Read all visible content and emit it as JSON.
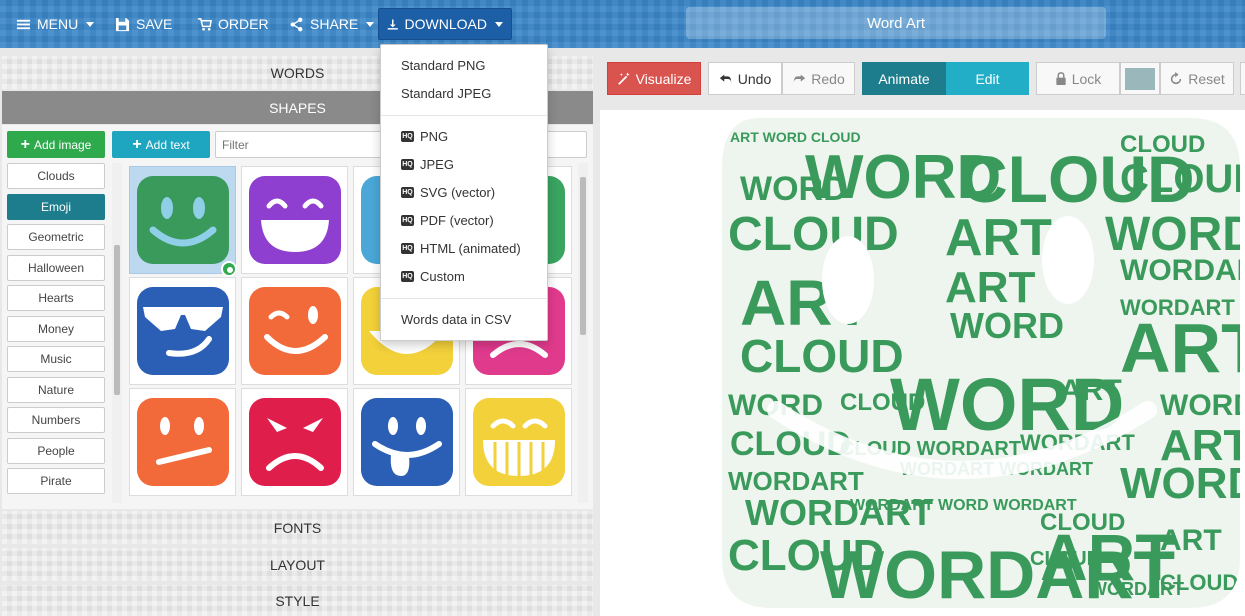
{
  "topbar": {
    "menu": "MENU",
    "save": "SAVE",
    "order": "ORDER",
    "share": "SHARE",
    "download": "DOWNLOAD",
    "title": "Word Art"
  },
  "panels": {
    "words": "WORDS",
    "shapes": "SHAPES",
    "fonts": "FONTS",
    "layout": "LAYOUT",
    "style": "STYLE"
  },
  "shapes": {
    "add_image": "Add image",
    "add_text": "Add text",
    "filter_placeholder": "Filter",
    "categories": [
      "Clouds",
      "Emoji",
      "Geometric",
      "Halloween",
      "Hearts",
      "Money",
      "Music",
      "Nature",
      "Numbers",
      "People",
      "Pirate"
    ],
    "selected_category": "Emoji",
    "emoji_colors": [
      "#3a9a5b",
      "#8e3fd0",
      "#4aa7d6",
      "#3aa460",
      "#2a5fb5",
      "#f26a3a",
      "#f3d13a",
      "#e03a8c",
      "#f26a3a",
      "#e01e4c",
      "#2a5fb5",
      "#f3d13a"
    ]
  },
  "download_menu": {
    "items": [
      "Standard PNG",
      "Standard JPEG"
    ],
    "hd_badge": "HQ",
    "hd_items": [
      "PNG",
      "JPEG",
      "SVG (vector)",
      "PDF (vector)",
      "HTML (animated)",
      "Custom"
    ],
    "csv": "Words data in CSV"
  },
  "toolbar": {
    "visualize": "Visualize",
    "undo": "Undo",
    "redo": "Redo",
    "animate": "Animate",
    "edit": "Edit",
    "lock": "Lock",
    "reset": "Reset"
  },
  "wordart": {
    "words": [
      "WORD",
      "CLOUD",
      "ART",
      "WORDART"
    ],
    "color": "#3a9a5b"
  }
}
